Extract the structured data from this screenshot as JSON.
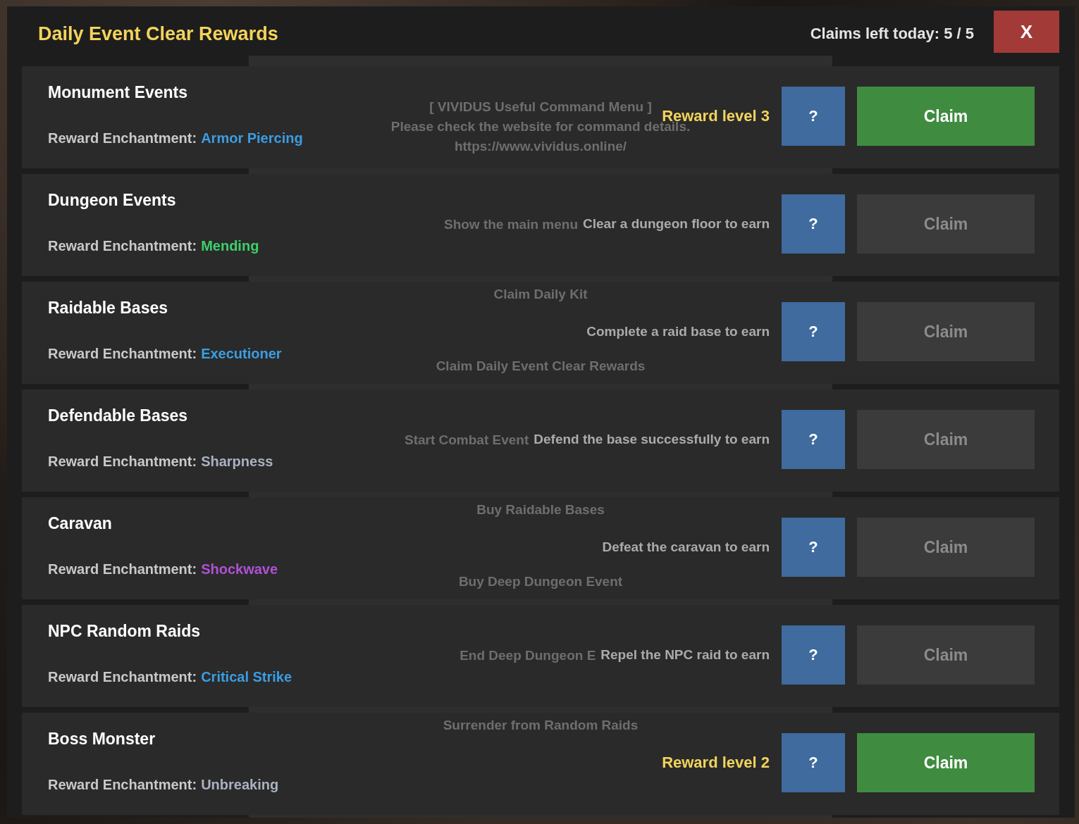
{
  "header": {
    "title": "Daily Event Clear Rewards",
    "claims_left": "Claims left today: 5 / 5",
    "close_button": "X"
  },
  "events": [
    {
      "name": "Monument Events",
      "reward_label": "Reward Enchantment:",
      "enchantment": {
        "text": "Armor Piercing",
        "color": "#3b9de2"
      },
      "status": {
        "kind": "level",
        "text": "Reward level 3"
      },
      "help_button": "?",
      "claim_button": {
        "label": "Claim",
        "disabled": false
      },
      "background_menu_text": [
        {
          "kind": "heading",
          "text": "[ VIVIDUS Useful Command Menu ]"
        },
        {
          "kind": "heading",
          "text": "Please check the website for command details."
        },
        {
          "kind": "heading",
          "text": "https://www.vividus.online/"
        }
      ]
    },
    {
      "name": "Dungeon Events",
      "reward_label": "Reward Enchantment:",
      "enchantment": {
        "text": "Mending",
        "color": "#3ecf6b"
      },
      "status": {
        "kind": "hint",
        "text": "Clear a dungeon floor to earn"
      },
      "help_button": "?",
      "claim_button": {
        "label": "Claim",
        "disabled": true
      },
      "background_menu_text": [
        {
          "kind": "cut",
          "text": "Show the main menu"
        }
      ]
    },
    {
      "name": "Raidable Bases",
      "reward_label": "Reward Enchantment:",
      "enchantment": {
        "text": "Executioner",
        "color": "#3b9de2"
      },
      "status": {
        "kind": "hint",
        "text": "Complete a raid base to earn"
      },
      "help_button": "?",
      "claim_button": {
        "label": "Claim",
        "disabled": true
      },
      "background_menu_text": [
        {
          "kind": "item",
          "text": "Claim Daily Kit"
        },
        {
          "kind": "item",
          "text": "Claim Daily Event Clear Rewards"
        }
      ]
    },
    {
      "name": "Defendable Bases",
      "reward_label": "Reward Enchantment:",
      "enchantment": {
        "text": "Sharpness",
        "color": "#a9b2bf"
      },
      "status": {
        "kind": "hint",
        "text": "Defend the base successfully to earn"
      },
      "help_button": "?",
      "claim_button": {
        "label": "Claim",
        "disabled": true
      },
      "background_menu_text": [
        {
          "kind": "cut",
          "text": "Start Combat Event"
        }
      ]
    },
    {
      "name": "Caravan",
      "reward_label": "Reward Enchantment:",
      "enchantment": {
        "text": "Shockwave",
        "color": "#b051d6"
      },
      "status": {
        "kind": "hint",
        "text": "Defeat the caravan to earn"
      },
      "help_button": "?",
      "claim_button": {
        "label": "Claim",
        "disabled": true
      },
      "background_menu_text": [
        {
          "kind": "item",
          "text": "Buy Raidable Bases"
        },
        {
          "kind": "item",
          "text": "Buy Deep Dungeon Event"
        }
      ]
    },
    {
      "name": "NPC Random Raids",
      "reward_label": "Reward Enchantment:",
      "enchantment": {
        "text": "Critical Strike",
        "color": "#3b9de2"
      },
      "status": {
        "kind": "hint",
        "text": "Repel the NPC raid to earn"
      },
      "help_button": "?",
      "claim_button": {
        "label": "Claim",
        "disabled": true
      },
      "background_menu_text": [
        {
          "kind": "cut",
          "text": "End Deep Dungeon E"
        }
      ]
    },
    {
      "name": "Boss Monster",
      "reward_label": "Reward Enchantment:",
      "enchantment": {
        "text": "Unbreaking",
        "color": "#a9b2bf"
      },
      "status": {
        "kind": "level",
        "text": "Reward level 2"
      },
      "help_button": "?",
      "claim_button": {
        "label": "Claim",
        "disabled": false
      },
      "background_menu_text": [
        {
          "kind": "item",
          "text": "Surrender from Random Raids"
        }
      ]
    }
  ]
}
